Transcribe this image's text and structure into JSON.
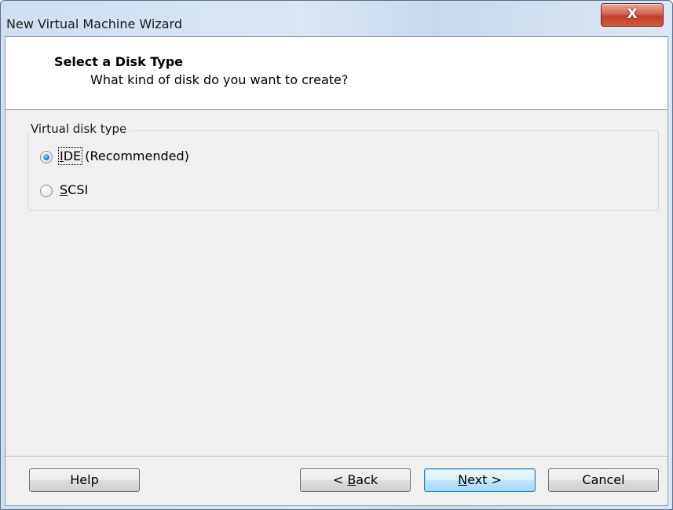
{
  "window": {
    "title": "New Virtual Machine Wizard",
    "close_glyph": "X"
  },
  "header": {
    "title": "Select a Disk Type",
    "subtitle": "What kind of disk do you want to create?"
  },
  "disk_type_group": {
    "label": "Virtual disk type",
    "options": [
      {
        "accel": "I",
        "rest": "DE",
        "suffix": " (Recommended)",
        "selected": true
      },
      {
        "accel": "S",
        "rest": "CSI",
        "suffix": "",
        "selected": false
      }
    ]
  },
  "buttons": {
    "help": "Help",
    "back_prefix": "< ",
    "back_accel": "B",
    "back_rest": "ack",
    "next_accel": "N",
    "next_rest": "ext >",
    "cancel": "Cancel"
  },
  "colors": {
    "accent": "#3c7fb1",
    "close_button": "#c2402a",
    "title_bar": "#cfdff0"
  },
  "icons": {
    "close": "close-icon",
    "radio_selected": "radio-selected-icon",
    "radio_unselected": "radio-unselected-icon"
  }
}
